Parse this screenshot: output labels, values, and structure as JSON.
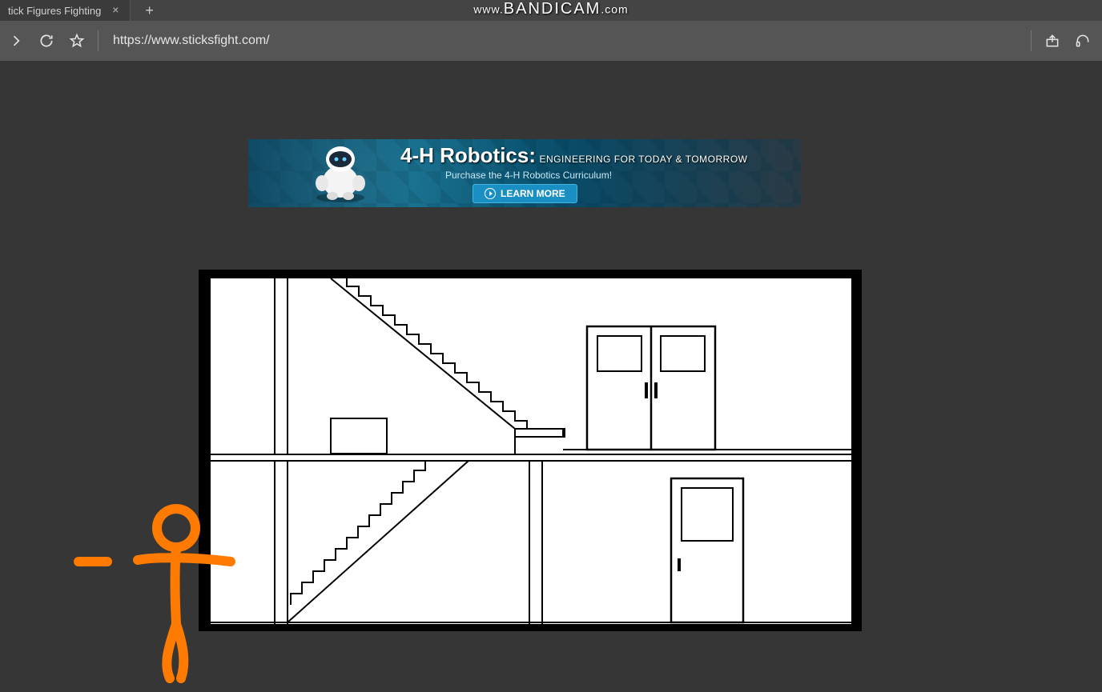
{
  "browser": {
    "tab_title": "tick Figures Fighting",
    "url": "https://www.sticksfight.com/"
  },
  "watermark": {
    "prefix": "www.",
    "brand": "BANDICAM",
    "suffix": ".com"
  },
  "ad": {
    "title_main": "4-H Robotics:",
    "title_sub": "ENGINEERING FOR TODAY & TOMORROW",
    "subtitle": "Purchase the 4-H Robotics Curriculum!",
    "cta": "LEARN MORE"
  }
}
